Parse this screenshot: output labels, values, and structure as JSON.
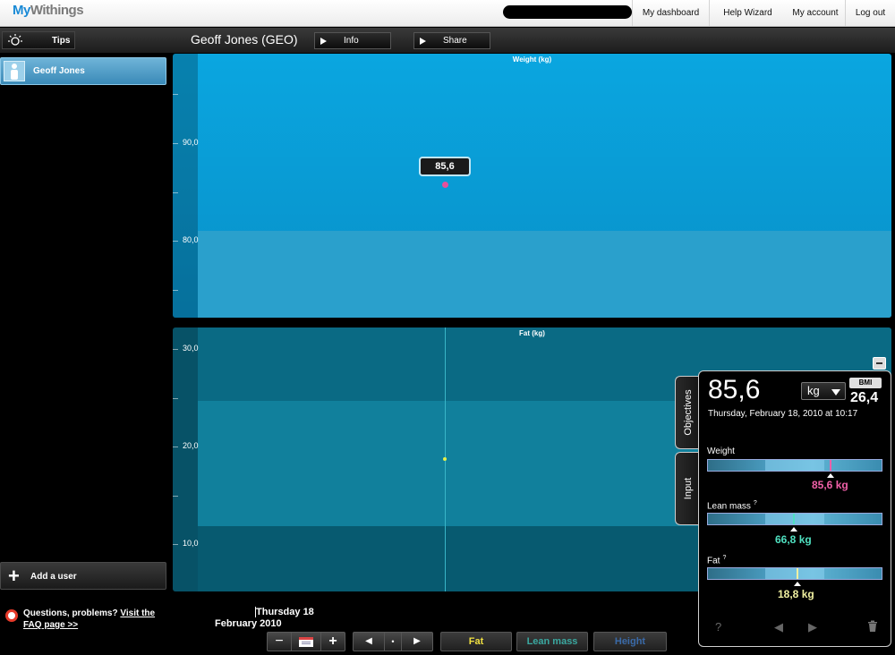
{
  "header": {
    "logo_my": "My",
    "logo_withings": "Withings",
    "nav": [
      "My dashboard",
      "Help Wizard",
      "My account",
      "Log out"
    ]
  },
  "toolbar": {
    "tips_label": "Tips",
    "user_title": "Geoff Jones (GEO)",
    "info_label": "Info",
    "share_label": "Share"
  },
  "sidebar": {
    "user_name": "Geoff Jones",
    "add_user_label": "Add a user",
    "faq_question": "Questions, problems?",
    "faq_link_1": "Visit the",
    "faq_link_2": "FAQ page >>"
  },
  "weight_chart": {
    "title": "Weight (kg)",
    "ticks": [
      "90,0",
      "80,0"
    ],
    "tooltip": "85,6"
  },
  "fat_chart": {
    "title": "Fat (kg)",
    "ticks": [
      "30,0",
      "20,0",
      "10,0"
    ]
  },
  "date": {
    "line1": "Thursday 18",
    "line2": "February 2010"
  },
  "bottom_tabs": [
    {
      "label": "Fat",
      "color": "#f0e040"
    },
    {
      "label": "Lean mass",
      "color": "#3aa8a0"
    },
    {
      "label": "Height",
      "color": "#3a6aa8"
    }
  ],
  "panel": {
    "tab_objectives": "Objectives",
    "tab_input": "Input",
    "value": "85,6",
    "unit": "kg",
    "bmi_label": "BMI",
    "bmi_value": "26,4",
    "timestamp": "Thursday, February 18, 2010 at 10:17",
    "measures": [
      {
        "label": "Weight",
        "value": "85,6 kg",
        "color": "#f060a8",
        "help": "",
        "position": 0.7
      },
      {
        "label": "Lean mass",
        "value": "66,8 kg",
        "color": "#4fe0c0",
        "help": "?",
        "position": 0.49
      },
      {
        "label": "Fat",
        "value": "18,8 kg",
        "color": "#f0f0a0",
        "help": "?",
        "position": 0.51
      }
    ],
    "help_icon": "?"
  },
  "colors": {
    "weight_chart_bg": "#0aa6e0",
    "fat_chart_bg": "#0a6a84",
    "accent_blue": "#1a8ad6"
  }
}
